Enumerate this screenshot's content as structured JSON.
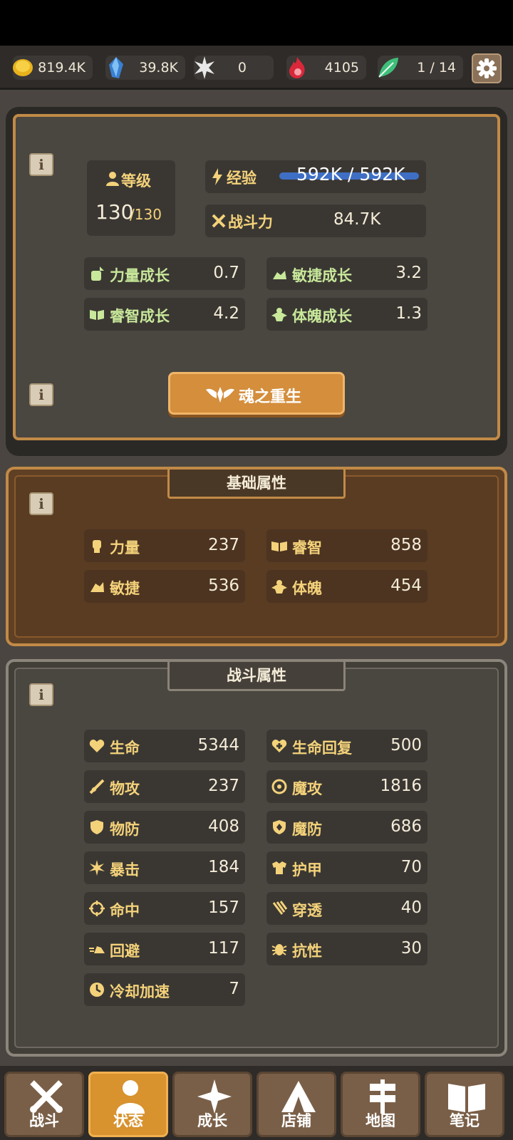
{
  "resources": {
    "gold": "819.4K",
    "crystal": "39.8K",
    "star": "0",
    "flame": "4105",
    "leaf": "1 / 14"
  },
  "profile": {
    "level_label": "等级",
    "level_current": "130",
    "level_max": "/130",
    "exp_label": "经验",
    "exp_value": "592K / 592K",
    "exp_progress": 1.0,
    "power_label": "战斗力",
    "power_value": "84.7K",
    "growth": [
      {
        "label": "力量成长",
        "value": "0.7"
      },
      {
        "label": "敏捷成长",
        "value": "3.2"
      },
      {
        "label": "睿智成长",
        "value": "4.2"
      },
      {
        "label": "体魄成长",
        "value": "1.3"
      }
    ],
    "rebirth_label": "魂之重生"
  },
  "basic": {
    "title": "基础属性",
    "stats": [
      {
        "label": "力量",
        "value": "237"
      },
      {
        "label": "睿智",
        "value": "858"
      },
      {
        "label": "敏捷",
        "value": "536"
      },
      {
        "label": "体魄",
        "value": "454"
      }
    ]
  },
  "combat": {
    "title": "战斗属性",
    "stats": [
      {
        "label": "生命",
        "value": "5344"
      },
      {
        "label": "生命回复",
        "value": "500"
      },
      {
        "label": "物攻",
        "value": "237"
      },
      {
        "label": "魔攻",
        "value": "1816"
      },
      {
        "label": "物防",
        "value": "408"
      },
      {
        "label": "魔防",
        "value": "686"
      },
      {
        "label": "暴击",
        "value": "184"
      },
      {
        "label": "护甲",
        "value": "70"
      },
      {
        "label": "命中",
        "value": "157"
      },
      {
        "label": "穿透",
        "value": "40"
      },
      {
        "label": "回避",
        "value": "117"
      },
      {
        "label": "抗性",
        "value": "30"
      },
      {
        "label": "冷却加速",
        "value": "7"
      }
    ]
  },
  "nav": [
    {
      "label": "战斗",
      "icon": "crossed-swords-icon"
    },
    {
      "label": "状态",
      "icon": "person-icon"
    },
    {
      "label": "成长",
      "icon": "sparkle-icon"
    },
    {
      "label": "店铺",
      "icon": "tent-icon"
    },
    {
      "label": "地图",
      "icon": "signpost-icon"
    },
    {
      "label": "笔记",
      "icon": "book-icon"
    }
  ],
  "nav_active": "状态",
  "info_symbol": "i",
  "colors": {
    "accent": "#d8922e",
    "growth_text": "#c8e89a",
    "label_gold": "#f4d27a",
    "exp_bar": "#3f6fc4"
  }
}
